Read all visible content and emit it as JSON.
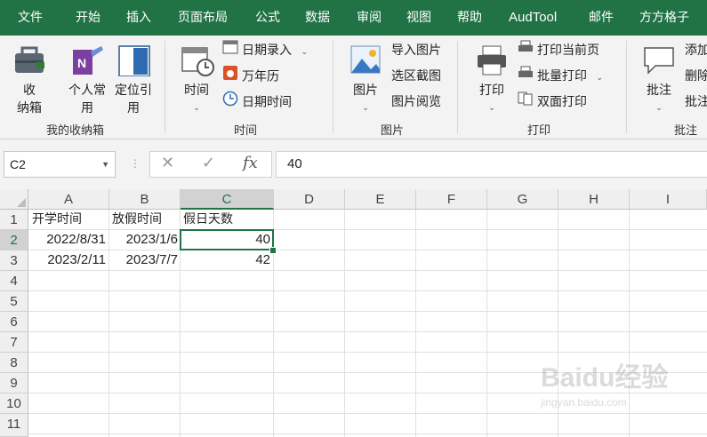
{
  "tabs": [
    "文件",
    "开始",
    "插入",
    "页面布局",
    "公式",
    "数据",
    "审阅",
    "视图",
    "帮助",
    "AudTool",
    "邮件",
    "方方格子"
  ],
  "ribbon": {
    "groups": {
      "storage": {
        "label": "我的收纳箱",
        "buttons": [
          "收\n纳箱",
          "个人常\n用",
          "定位引\n用"
        ]
      },
      "time": {
        "label": "时间",
        "big": "时间",
        "items": [
          "日期录入",
          "万年历",
          "日期时间"
        ]
      },
      "picture": {
        "label": "图片",
        "big": "图片",
        "items": [
          "导入图片",
          "选区截图",
          "图片阅览"
        ]
      },
      "print": {
        "label": "打印",
        "big": "打印",
        "items": [
          "打印当前页",
          "批量打印",
          "双面打印"
        ]
      },
      "comment": {
        "label": "批注",
        "big": "批注",
        "items": [
          "添加",
          "删除",
          "批注"
        ]
      }
    }
  },
  "formula_bar": {
    "name_box": "C2",
    "value": "40"
  },
  "sheet": {
    "columns": [
      "A",
      "B",
      "C",
      "D",
      "E",
      "F",
      "G",
      "H",
      "I"
    ],
    "rows": [
      "1",
      "2",
      "3",
      "4",
      "5",
      "6",
      "7",
      "8",
      "9",
      "10",
      "11"
    ],
    "cells": {
      "A1": "开学时间",
      "B1": "放假时间",
      "C1": "假日天数",
      "A2": "2022/8/31",
      "B2": "2023/1/6",
      "C2": "40",
      "A3": "2023/2/11",
      "B3": "2023/7/7",
      "C3": "42"
    }
  },
  "watermark": {
    "text": "Baidu经验",
    "sub": "jingyan.baidu.com"
  }
}
